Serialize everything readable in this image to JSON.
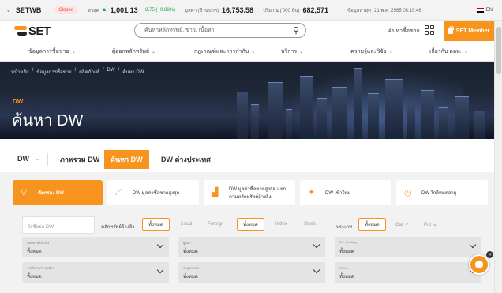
{
  "ticker": {
    "index_name": "SETWB",
    "market_status": "Closed",
    "last_label": "ล่าสุด",
    "last_value": "1,001.13",
    "change": "+8.75 (+0.88%)",
    "value_label": "มูลค่า (ล้านบาท)",
    "value": "16,753.58",
    "volume_label": "ปริมาณ ('000 หุ้น)",
    "volume": "682,571",
    "updated_label": "ข้อมูลล่าสุด",
    "updated": "21 พ.ค. 2565 03:19:46",
    "lang": "EN"
  },
  "header": {
    "logo": "SET",
    "search_placeholder": "ค้นหาหลักทรัพย์, ข่าว, เนื้อหา",
    "fav_link": "ค้นหาซื้อขาย",
    "member_button": "SET Member"
  },
  "mainnav": [
    {
      "label": "ข้อมูลการซื้อขาย"
    },
    {
      "label": "ผู้ออกหลักทรัพย์"
    },
    {
      "label": "กฎเกณฑ์และการกำกับ"
    },
    {
      "label": "บริการ"
    },
    {
      "label": "ความรู้และวิจัย"
    },
    {
      "label": "เกี่ยวกับ ตลท."
    }
  ],
  "breadcrumb": [
    "หน้าหลัก",
    "ข้อมูลการซื้อขาย",
    "ผลิตภัณฑ์",
    "DW",
    "ค้นหา DW"
  ],
  "banner": {
    "tag": "DW",
    "title": "ค้นหา DW"
  },
  "subtabs": {
    "selector": "DW",
    "tabs": [
      "ภาพรวม DW",
      "ค้นหา DW",
      "DW ต่างประเทศ"
    ],
    "active": 1
  },
  "cards": [
    {
      "label": "คัดกรอง DW",
      "icon": "filter-icon"
    },
    {
      "label": "DW มูลค่าซื้อขายสูงสุด",
      "icon": "trend-chart-icon"
    },
    {
      "label": "DW มูลค่าซื้อขายสูงสุด แยกตามหลักทรัพย์อ้างอิง",
      "icon": "bar-chart-icon"
    },
    {
      "label": "DW เข้าใหม่",
      "icon": "new-badge-icon"
    },
    {
      "label": "DW ใกล้หมดอายุ",
      "icon": "calendar-clock-icon"
    }
  ],
  "filters": {
    "symbol_placeholder": "ใส่ชื่อย่อ DW",
    "underlying_label": "หลักทรัพย์อ้างอิง",
    "underlying_opts": [
      "ทั้งหมด",
      "Local",
      "Foreign"
    ],
    "type_opts": [
      "ทั้งหมด",
      "Index",
      "Stock"
    ],
    "kind_label": "ประเภท",
    "kind_opts": [
      "ทั้งหมด",
      "Call ↗",
      "Put ↘"
    ],
    "dropdowns": [
      {
        "caption": "หลักทรัพย์อ้างอิง",
        "value": "ทั้งหมด"
      },
      {
        "caption": "ผู้ออก",
        "value": "ทั้งหมด"
      },
      {
        "caption": "EX. Quoting",
        "value": "ทั้งหมด"
      },
      {
        "caption": "วันซื้อขายวันสุดท้าย",
        "value": "ทั้งหมด"
      },
      {
        "caption": "อายุคงเหลือ",
        "value": "ทั้งหมด"
      },
      {
        "caption": "สถานะ",
        "value": "ทั้งหมด"
      }
    ]
  }
}
